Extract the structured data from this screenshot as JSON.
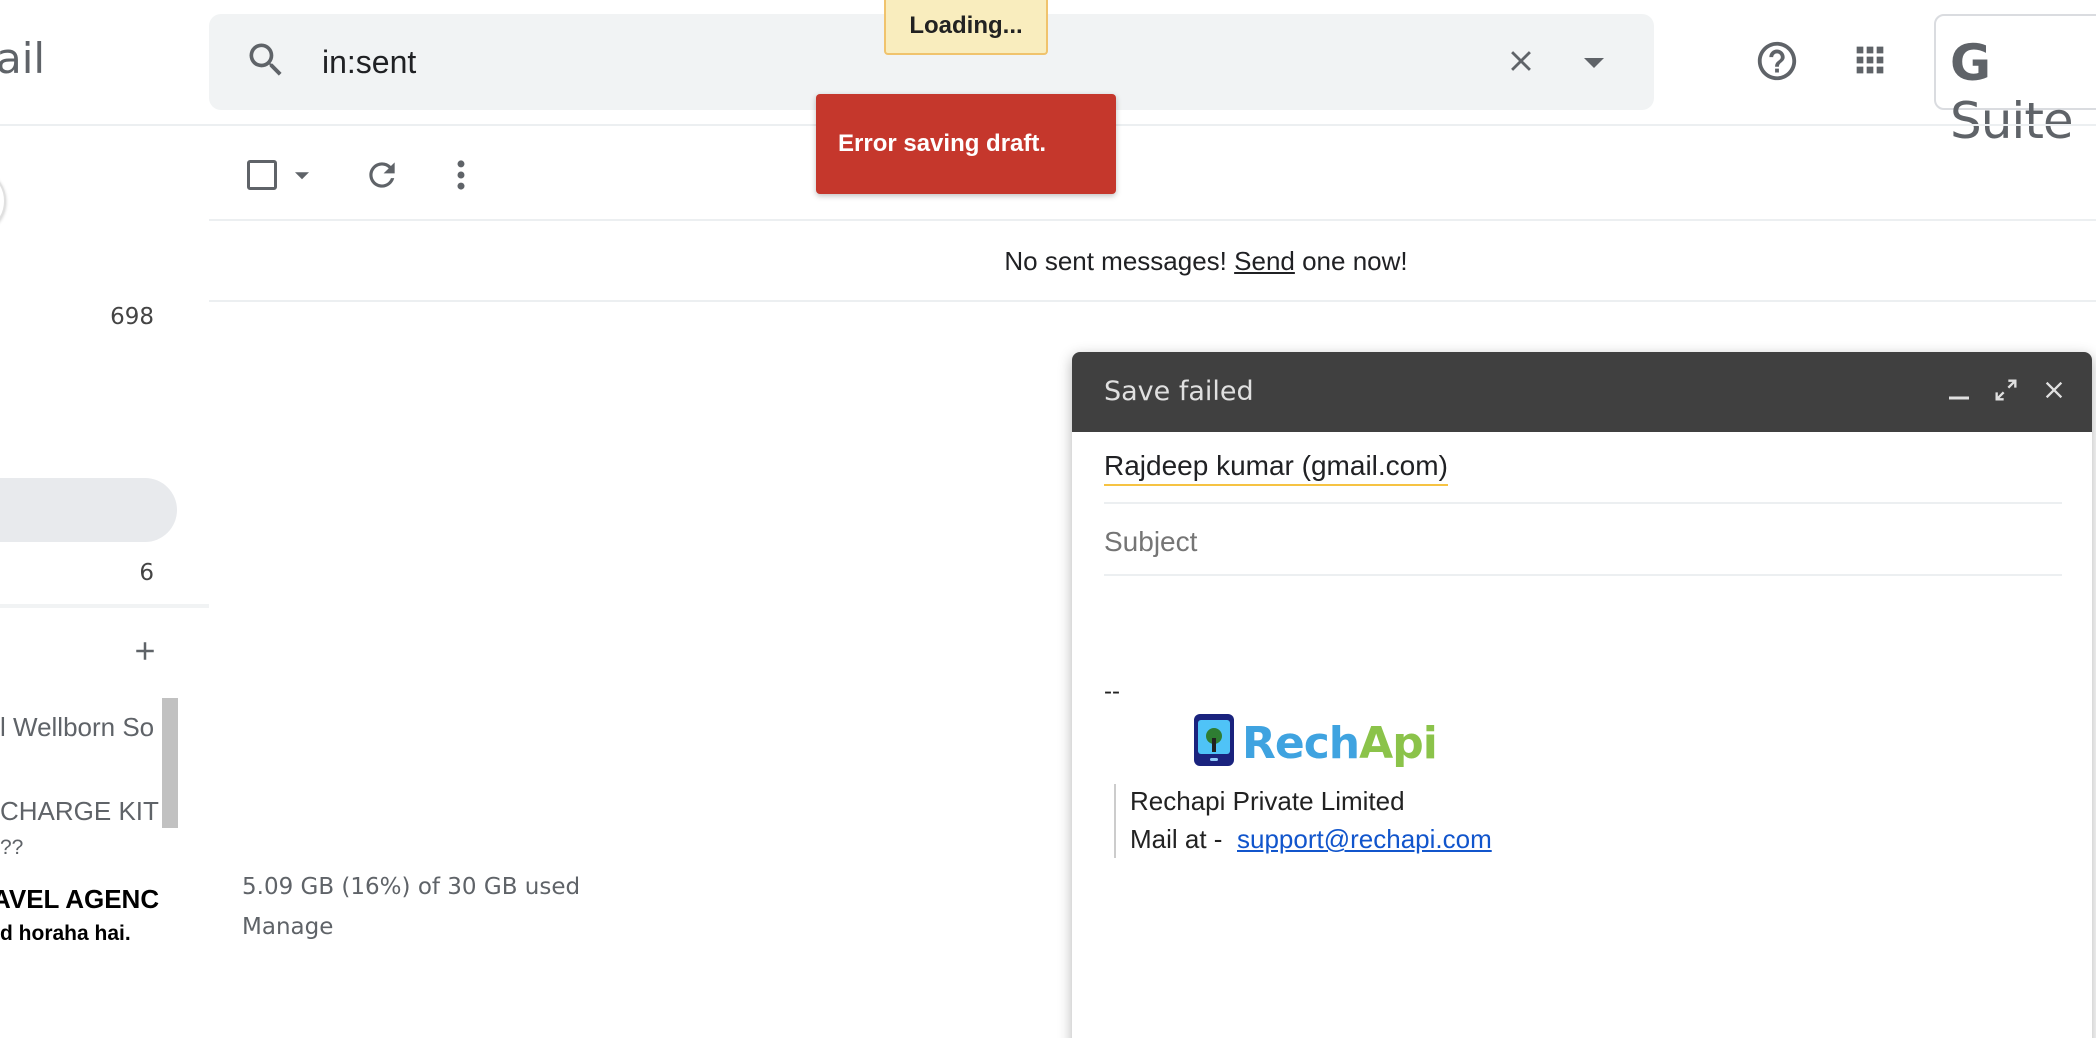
{
  "header": {
    "logo_text": "ail",
    "search_value": "in:sent",
    "brand_text": "Suite"
  },
  "toasts": {
    "loading": "Loading...",
    "error": "Error saving draft."
  },
  "list": {
    "empty_prefix": "No sent messages! ",
    "empty_link": "Send",
    "empty_suffix": " one now!"
  },
  "sidebar": {
    "inbox_count": "698",
    "item_count": "6",
    "chat_lines": [
      "l Wellborn So",
      "CHARGE KIT"
    ],
    "chat_line_3": "??",
    "travel_line": "AVEL AGENC",
    "horaha_line": "d horaha hai."
  },
  "storage": {
    "usage": "5.09 GB (16%) of 30 GB used",
    "manage": "Manage"
  },
  "compose": {
    "title": "Save failed",
    "recipient": "Rajdeep kumar (gmail.com)",
    "subject_placeholder": "Subject",
    "signature": {
      "dashes": "--",
      "logo_part_1": "Rech",
      "logo_part_2": "Api",
      "company": "Rechapi Private Limited",
      "mail_label": "Mail at -",
      "email": "support@rechapi.com"
    }
  },
  "colors": {
    "error_toast": "#c5372c",
    "loading_toast": "#f9edbe",
    "compose_header": "#404040",
    "link": "#1155cc"
  },
  "icons": [
    "search-icon",
    "clear-icon",
    "search-options-icon",
    "help-icon",
    "apps-icon",
    "select-caret-icon",
    "refresh-icon",
    "more-icon",
    "add-label-icon",
    "minimize-icon",
    "fullscreen-icon",
    "close-compose-icon",
    "rechapi-logo-icon"
  ]
}
